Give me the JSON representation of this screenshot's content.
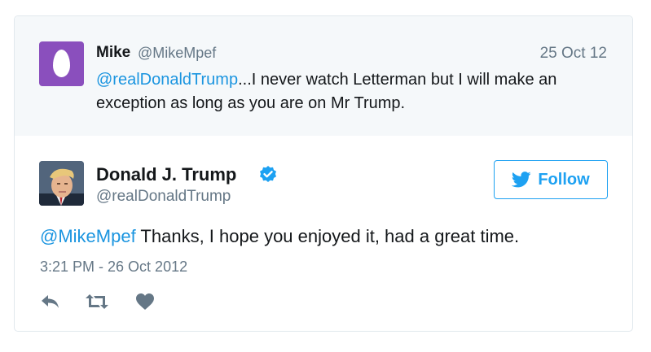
{
  "parent_tweet": {
    "name": "Mike",
    "handle": "@MikeMpef",
    "date": "25 Oct 12",
    "mention": "@realDonaldTrump",
    "text": "...I never watch Letterman but I will make an exception as long as you are on Mr Trump."
  },
  "tweet": {
    "name": "Donald J. Trump",
    "handle": "@realDonaldTrump",
    "follow_label": "Follow",
    "mention": "@MikeMpef",
    "text": " Thanks, I hope you enjoyed it, had a great time.",
    "timestamp": "3:21 PM - 26 Oct 2012"
  },
  "icons": {
    "verified": "verified-badge-icon",
    "follow": "twitter-bird-icon",
    "reply": "reply-icon",
    "retweet": "retweet-icon",
    "like": "heart-icon"
  },
  "colors": {
    "link": "#1b95e0",
    "brand": "#1da1f2",
    "muted": "#657786",
    "egg_avatar": "#8a4fbd",
    "icon_gray": "#657786"
  }
}
